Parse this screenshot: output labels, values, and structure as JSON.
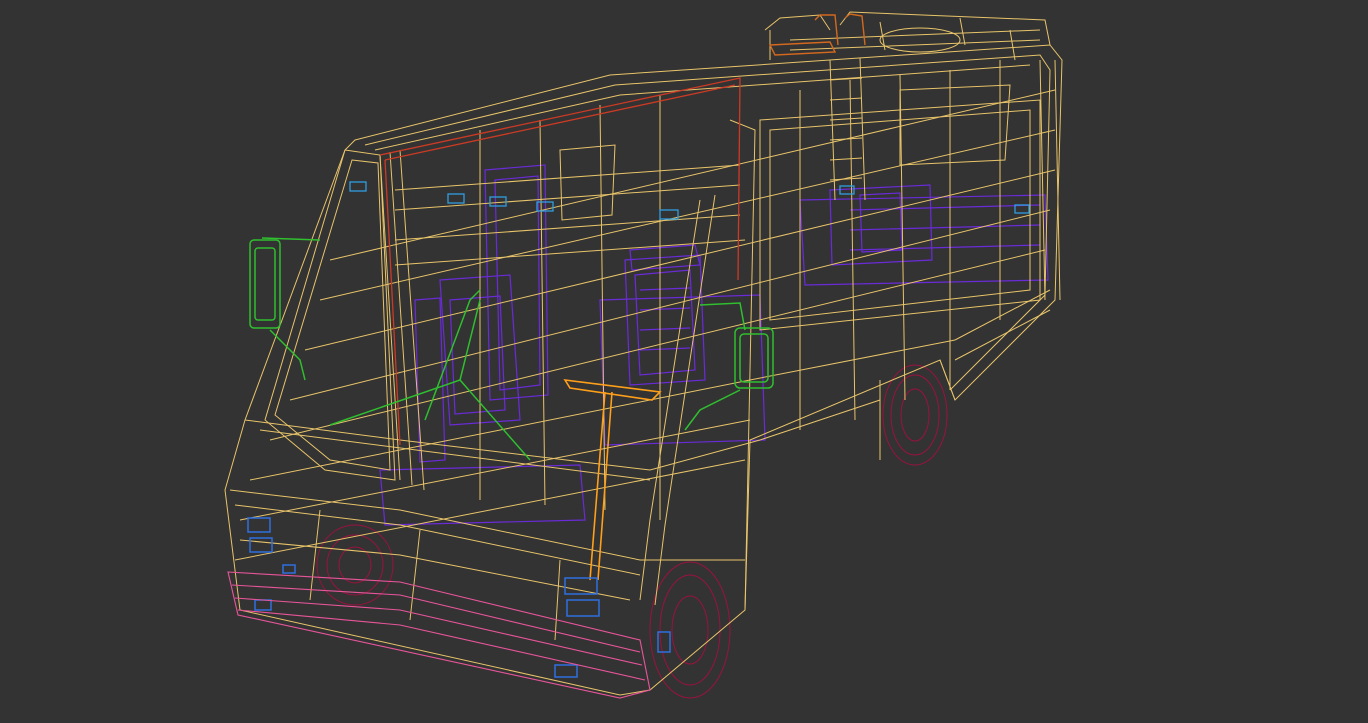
{
  "viewport": {
    "background": "#333333",
    "model": "wireframe-motorhome"
  },
  "colors": {
    "body": "#e8c46a",
    "trim_red": "#cc3a24",
    "interior": "#6a2bd8",
    "mirrors": "#2fbf2f",
    "steering": "#ff9f1a",
    "lights": "#2f6fe0",
    "bumper": "#e8559a",
    "wheels": "#9a1240",
    "ladder": "#d2691e"
  }
}
